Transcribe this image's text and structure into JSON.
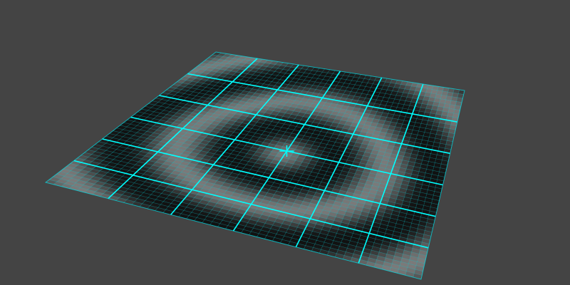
{
  "viewport": {
    "background_color": "#444444"
  },
  "mesh": {
    "object": "subdivided-plane",
    "tile_color": "#7a7a7a",
    "dark_color": "#111111",
    "wire_color": "#00e5ee",
    "major_line_color": "#00ffff",
    "fine_divisions": 48,
    "major_divisions": 6,
    "pattern": "concentric-ripple",
    "selection_state": "selected-wireframe-overlay"
  }
}
